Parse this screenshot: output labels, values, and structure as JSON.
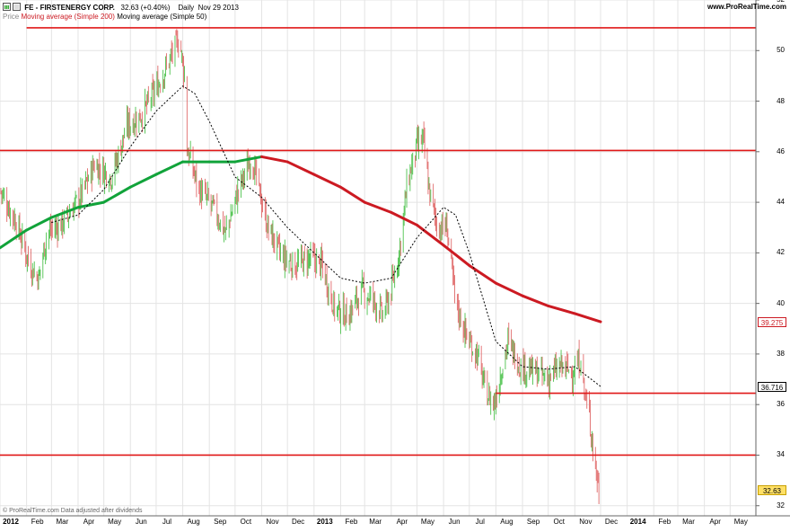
{
  "header": {
    "title": "FE - FIRSTENERGY CORP.",
    "quote": "32.63 (+0.40%)",
    "period": "Daily",
    "date": "Nov 29 2013",
    "site": "www.ProRealTime.com"
  },
  "indicators": {
    "price_label": "Price",
    "ma200_label": "Moving average (Simple 200)",
    "ma50_label": "Moving average (Simple 50)"
  },
  "footer": {
    "note": "© ProRealTime.com  Data adjusted after dividends"
  },
  "colors": {
    "up": "#4dc24d",
    "down": "#e06a6a",
    "ma200_up": "#11a33a",
    "ma200_down": "#cc1a22",
    "ma50": "#000000",
    "level": "#e01818",
    "grid": "#e4e4e4"
  },
  "value_labels": {
    "ma200": "39.275",
    "ma50": "36.716",
    "last": "32.63"
  },
  "chart_data": {
    "type": "candlestick",
    "title": "FE - FIRSTENERGY CORP.",
    "xlim": [
      "2012-01-01",
      "2014-05-31"
    ],
    "ylim": [
      31.6,
      52
    ],
    "y_ticks": [
      32,
      34,
      36,
      38,
      40,
      42,
      44,
      46,
      48,
      50,
      52
    ],
    "x_ticks": [
      {
        "date": "2012-01-01",
        "label": "2012",
        "bold": true
      },
      {
        "date": "2012-02-01",
        "label": "Feb"
      },
      {
        "date": "2012-03-01",
        "label": "Mar"
      },
      {
        "date": "2012-04-01",
        "label": "Apr"
      },
      {
        "date": "2012-05-01",
        "label": "May"
      },
      {
        "date": "2012-06-01",
        "label": "Jun"
      },
      {
        "date": "2012-07-01",
        "label": "Jul"
      },
      {
        "date": "2012-08-01",
        "label": "Aug"
      },
      {
        "date": "2012-09-01",
        "label": "Sep"
      },
      {
        "date": "2012-10-01",
        "label": "Oct"
      },
      {
        "date": "2012-11-01",
        "label": "Nov"
      },
      {
        "date": "2012-12-01",
        "label": "Dec"
      },
      {
        "date": "2013-01-01",
        "label": "2013",
        "bold": true
      },
      {
        "date": "2013-02-01",
        "label": "Feb"
      },
      {
        "date": "2013-03-01",
        "label": "Mar"
      },
      {
        "date": "2013-04-01",
        "label": "Apr"
      },
      {
        "date": "2013-05-01",
        "label": "May"
      },
      {
        "date": "2013-06-01",
        "label": "Jun"
      },
      {
        "date": "2013-07-01",
        "label": "Jul"
      },
      {
        "date": "2013-08-01",
        "label": "Aug"
      },
      {
        "date": "2013-09-01",
        "label": "Sep"
      },
      {
        "date": "2013-10-01",
        "label": "Oct"
      },
      {
        "date": "2013-11-01",
        "label": "Nov"
      },
      {
        "date": "2013-12-01",
        "label": "Dec"
      },
      {
        "date": "2014-01-01",
        "label": "2014",
        "bold": true
      },
      {
        "date": "2014-02-01",
        "label": "Feb"
      },
      {
        "date": "2014-03-01",
        "label": "Mar"
      },
      {
        "date": "2014-04-01",
        "label": "Apr"
      },
      {
        "date": "2014-05-01",
        "label": "May"
      }
    ],
    "price_path": [
      [
        "2012-01-01",
        44.5
      ],
      [
        "2012-01-20",
        43.2
      ],
      [
        "2012-02-05",
        41.5
      ],
      [
        "2012-02-15",
        41.0
      ],
      [
        "2012-02-25",
        42.8
      ],
      [
        "2012-03-15",
        43.2
      ],
      [
        "2012-04-05",
        44.3
      ],
      [
        "2012-04-20",
        45.5
      ],
      [
        "2012-05-10",
        45.0
      ],
      [
        "2012-05-28",
        47.0
      ],
      [
        "2012-06-15",
        47.5
      ],
      [
        "2012-07-01",
        48.5
      ],
      [
        "2012-07-15",
        49.5
      ],
      [
        "2012-07-28",
        50.5
      ],
      [
        "2012-08-03",
        49.0
      ],
      [
        "2012-08-05",
        46.2
      ],
      [
        "2012-08-20",
        44.5
      ],
      [
        "2012-09-05",
        43.8
      ],
      [
        "2012-09-20",
        42.8
      ],
      [
        "2012-10-05",
        44.5
      ],
      [
        "2012-10-20",
        45.8
      ],
      [
        "2012-11-01",
        44.0
      ],
      [
        "2012-11-08",
        43.0
      ],
      [
        "2012-11-25",
        41.8
      ],
      [
        "2012-12-10",
        41.5
      ],
      [
        "2012-12-28",
        41.8
      ],
      [
        "2013-01-10",
        41.5
      ],
      [
        "2013-01-25",
        39.8
      ],
      [
        "2013-02-10",
        39.5
      ],
      [
        "2013-02-25",
        40.5
      ],
      [
        "2013-03-10",
        40.2
      ],
      [
        "2013-03-22",
        39.5
      ],
      [
        "2013-04-01",
        40.5
      ],
      [
        "2013-04-10",
        42.0
      ],
      [
        "2013-04-20",
        44.8
      ],
      [
        "2013-05-01",
        46.2
      ],
      [
        "2013-05-08",
        46.5
      ],
      [
        "2013-05-15",
        44.5
      ],
      [
        "2013-05-25",
        43.0
      ],
      [
        "2013-06-05",
        43.0
      ],
      [
        "2013-06-15",
        40.0
      ],
      [
        "2013-06-30",
        38.5
      ],
      [
        "2013-07-10",
        38.0
      ],
      [
        "2013-07-20",
        36.5
      ],
      [
        "2013-07-30",
        36.0
      ],
      [
        "2013-08-05",
        37.0
      ],
      [
        "2013-08-15",
        38.5
      ],
      [
        "2013-08-30",
        37.5
      ],
      [
        "2013-09-15",
        37.3
      ],
      [
        "2013-09-30",
        37.0
      ],
      [
        "2013-10-15",
        37.5
      ],
      [
        "2013-10-30",
        37.3
      ],
      [
        "2013-11-08",
        37.8
      ],
      [
        "2013-11-12",
        36.5
      ],
      [
        "2013-11-18",
        35.5
      ],
      [
        "2013-11-25",
        33.5
      ],
      [
        "2013-11-29",
        32.63
      ]
    ],
    "ma200": [
      [
        "2012-01-01",
        42.2
      ],
      [
        "2012-02-01",
        42.9
      ],
      [
        "2012-03-01",
        43.4
      ],
      [
        "2012-04-01",
        43.8
      ],
      [
        "2012-05-01",
        44.0
      ],
      [
        "2012-06-01",
        44.6
      ],
      [
        "2012-07-01",
        45.1
      ],
      [
        "2012-08-01",
        45.6
      ],
      [
        "2012-09-01",
        45.6
      ],
      [
        "2012-10-01",
        45.6
      ],
      [
        "2012-11-01",
        45.8
      ],
      [
        "2012-12-01",
        45.6
      ],
      [
        "2013-01-01",
        45.1
      ],
      [
        "2013-02-01",
        44.6
      ],
      [
        "2013-03-01",
        44.0
      ],
      [
        "2013-04-01",
        43.6
      ],
      [
        "2013-05-01",
        43.1
      ],
      [
        "2013-06-01",
        42.3
      ],
      [
        "2013-07-01",
        41.5
      ],
      [
        "2013-08-01",
        40.8
      ],
      [
        "2013-09-01",
        40.3
      ],
      [
        "2013-10-01",
        39.9
      ],
      [
        "2013-11-01",
        39.6
      ],
      [
        "2013-12-01",
        39.275
      ]
    ],
    "ma50": [
      [
        "2012-03-01",
        43.2
      ],
      [
        "2012-04-01",
        43.5
      ],
      [
        "2012-05-01",
        44.5
      ],
      [
        "2012-06-01",
        46.2
      ],
      [
        "2012-07-01",
        47.6
      ],
      [
        "2012-08-01",
        48.6
      ],
      [
        "2012-08-15",
        48.3
      ],
      [
        "2012-09-01",
        47.2
      ],
      [
        "2012-10-01",
        45.0
      ],
      [
        "2012-11-01",
        44.2
      ],
      [
        "2012-12-01",
        43.0
      ],
      [
        "2013-01-01",
        42.0
      ],
      [
        "2013-02-01",
        41.0
      ],
      [
        "2013-03-01",
        40.8
      ],
      [
        "2013-04-01",
        41.0
      ],
      [
        "2013-05-01",
        42.6
      ],
      [
        "2013-06-01",
        43.8
      ],
      [
        "2013-06-15",
        43.5
      ],
      [
        "2013-07-01",
        42.0
      ],
      [
        "2013-08-01",
        38.5
      ],
      [
        "2013-09-01",
        37.5
      ],
      [
        "2013-10-01",
        37.4
      ],
      [
        "2013-11-01",
        37.5
      ],
      [
        "2013-12-01",
        36.716
      ]
    ],
    "levels": [
      {
        "from": "2012-02-01",
        "to": "2014-05-31",
        "value": 50.9
      },
      {
        "from": "2012-01-01",
        "to": "2014-05-31",
        "value": 46.05
      },
      {
        "from": "2013-08-01",
        "to": "2014-05-31",
        "value": 36.45
      },
      {
        "from": "2012-01-01",
        "to": "2014-05-31",
        "value": 34.0
      }
    ]
  }
}
